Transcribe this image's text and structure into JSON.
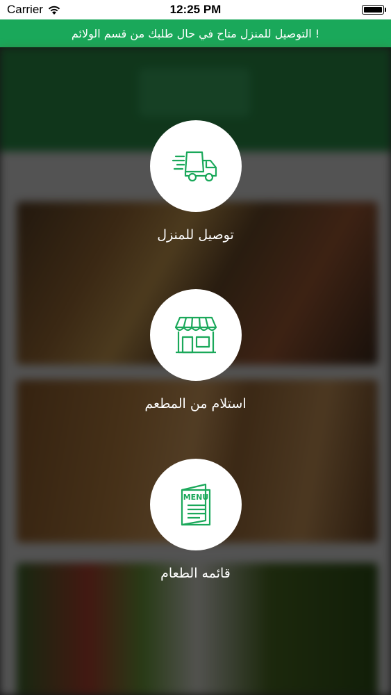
{
  "status_bar": {
    "carrier": "Carrier",
    "time": "12:25 PM",
    "battery_level": 1.0
  },
  "banner": {
    "text": "! التوصيل للمنزل متاح في حال طلبك من قسم الولائم"
  },
  "options": [
    {
      "label": "توصيل للمنزل",
      "icon": "delivery-truck-icon"
    },
    {
      "label": "استلام من المطعم",
      "icon": "storefront-icon"
    },
    {
      "label": "قائمه الطعام",
      "icon": "menu-icon",
      "icon_text": "MENU"
    }
  ],
  "colors": {
    "accent": "#1aa85a",
    "icon": "#1aa85a",
    "circle": "#ffffff"
  }
}
